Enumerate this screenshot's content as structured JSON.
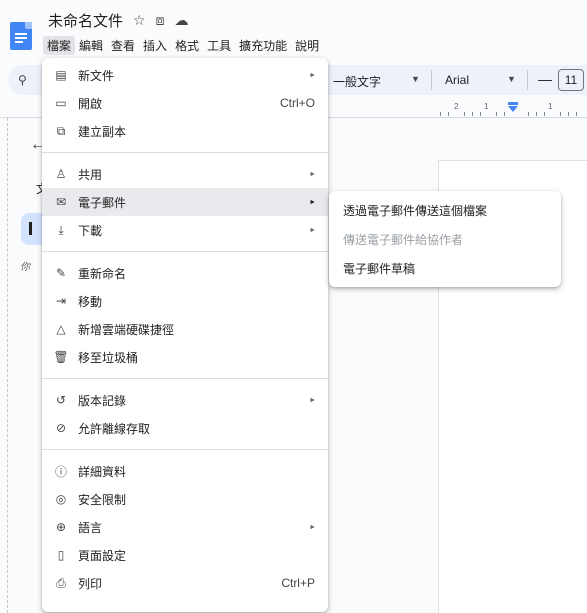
{
  "title_bar": {
    "doc_title": "未命名文件"
  },
  "menubar": [
    "檔案",
    "編輯",
    "查看",
    "插入",
    "格式",
    "工具",
    "擴充功能",
    "說明"
  ],
  "toolbar": {
    "style": "一般文字",
    "font": "Arial",
    "minus": "—",
    "font_size": "11"
  },
  "ruler": [
    "2",
    "1",
    "1"
  ],
  "sidebar": {
    "letter": "文",
    "hint": "你"
  },
  "menu": [
    {
      "label": "新文件",
      "icon": "document-icon",
      "glyph": "▤",
      "arrow": true
    },
    {
      "label": "開啟",
      "icon": "folder-icon",
      "glyph": "▭",
      "shortcut": "Ctrl+O"
    },
    {
      "label": "建立副本",
      "icon": "copy-icon",
      "glyph": "⧉"
    },
    {
      "sep": true
    },
    {
      "label": "共用",
      "icon": "person-add-icon",
      "glyph": "♙",
      "arrow": true
    },
    {
      "label": "電子郵件",
      "icon": "mail-icon",
      "glyph": "✉",
      "arrow": true,
      "highlight": true
    },
    {
      "label": "下載",
      "icon": "download-icon",
      "glyph": "⤓",
      "arrow": true
    },
    {
      "sep": true
    },
    {
      "label": "重新命名",
      "icon": "pencil-icon",
      "glyph": "✎"
    },
    {
      "label": "移動",
      "icon": "move-folder-icon",
      "glyph": "⇥"
    },
    {
      "label": "新增雲端硬碟捷徑",
      "icon": "drive-shortcut-icon",
      "glyph": "△"
    },
    {
      "label": "移至垃圾桶",
      "icon": "trash-icon",
      "glyph": "🗑"
    },
    {
      "sep": true
    },
    {
      "label": "版本記錄",
      "icon": "history-icon",
      "glyph": "↺",
      "arrow": true
    },
    {
      "label": "允許離線存取",
      "icon": "offline-icon",
      "glyph": "⊘"
    },
    {
      "sep": true
    },
    {
      "label": "詳細資料",
      "icon": "info-icon",
      "glyph": "ⓘ"
    },
    {
      "label": "安全限制",
      "icon": "shield-icon",
      "glyph": "◎"
    },
    {
      "label": "語言",
      "icon": "globe-icon",
      "glyph": "⊕",
      "arrow": true
    },
    {
      "label": "頁面設定",
      "icon": "page-setup-icon",
      "glyph": "▯"
    },
    {
      "label": "列印",
      "icon": "print-icon",
      "glyph": "⎙",
      "shortcut": "Ctrl+P"
    }
  ],
  "submenu": [
    {
      "label": "透過電子郵件傳送這個檔案",
      "disabled": false
    },
    {
      "label": "傳送電子郵件給協作者",
      "disabled": true
    },
    {
      "label": "電子郵件草稿",
      "disabled": false
    }
  ]
}
